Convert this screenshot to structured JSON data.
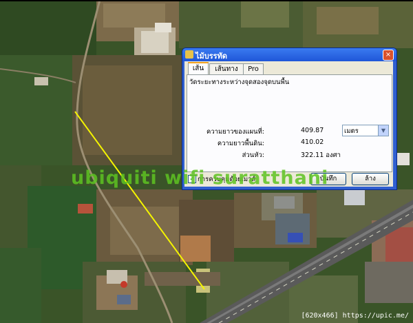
{
  "dialog": {
    "title": "ไม้บรรทัด",
    "close_glyph": "×",
    "tabs": [
      {
        "label": "เส้น"
      },
      {
        "label": "เส้นทาง"
      },
      {
        "label": "Pro"
      }
    ],
    "description": "วัดระยะทางระหว่างจุดสองจุดบนพื้น",
    "rows": [
      {
        "label": "ความยาวของแผนที่:",
        "value": "409.87"
      },
      {
        "label": "ความยาวพื้นดิน:",
        "value": "410.02"
      },
      {
        "label": "ส่วนหัว:",
        "value": "322.11 องศา"
      }
    ],
    "unit_selected": "เมตร",
    "show_mouse_nav_label": "การควบคุมด้วยเมาส์",
    "show_mouse_nav_checked": true,
    "save_label": "บันทึก",
    "clear_label": "ล้าง"
  },
  "watermark": "ubiquiti wifi suratthani",
  "footer": "[620x466] https://upic.me/",
  "colors": {
    "measure_line": "#f5f500",
    "watermark": "#5ec322",
    "titlebar": "#1f56d8"
  }
}
